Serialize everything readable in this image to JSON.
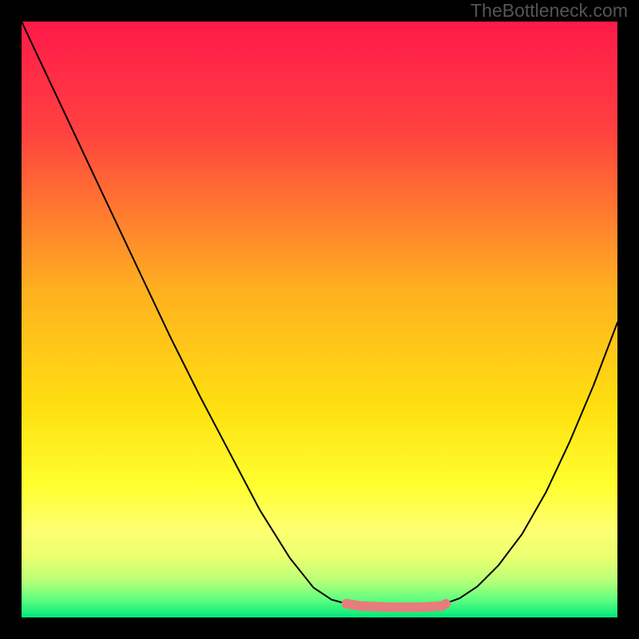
{
  "watermark": "TheBottleneck.com",
  "chart_data": {
    "type": "line",
    "title": "",
    "xlabel": "",
    "ylabel": "",
    "xlim": [
      0,
      100
    ],
    "ylim": [
      0,
      100
    ],
    "background_gradient": {
      "top_color": "#ff1a4a",
      "mid_color": "#ffd500",
      "bottom_colors": [
        "#ffff55",
        "#e8ff6a",
        "#7dff7d",
        "#00e97a"
      ]
    },
    "series": [
      {
        "name": "curve-left",
        "stroke": "#000000",
        "stroke_width": 2,
        "x": [
          0,
          4,
          8,
          12,
          16,
          20.5,
          25,
          30,
          35,
          40,
          45,
          49,
          52,
          54.5
        ],
        "y": [
          100,
          91.5,
          83,
          74.5,
          66,
          56.5,
          47,
          37,
          27.5,
          18,
          10,
          5,
          3,
          2.3
        ]
      },
      {
        "name": "curve-right",
        "stroke": "#000000",
        "stroke_width": 2,
        "x": [
          71,
          73.5,
          76.5,
          80,
          84,
          88,
          92,
          96,
          100
        ],
        "y": [
          2.3,
          3.2,
          5.2,
          8.7,
          14,
          21,
          29.5,
          39,
          49.5
        ]
      },
      {
        "name": "pink-band",
        "stroke": "#e77c7c",
        "stroke_width": 12,
        "x": [
          54.5,
          57,
          62,
          67,
          70.5,
          71.2
        ],
        "y": [
          2.3,
          1.9,
          1.7,
          1.7,
          1.9,
          2.3
        ]
      }
    ]
  }
}
